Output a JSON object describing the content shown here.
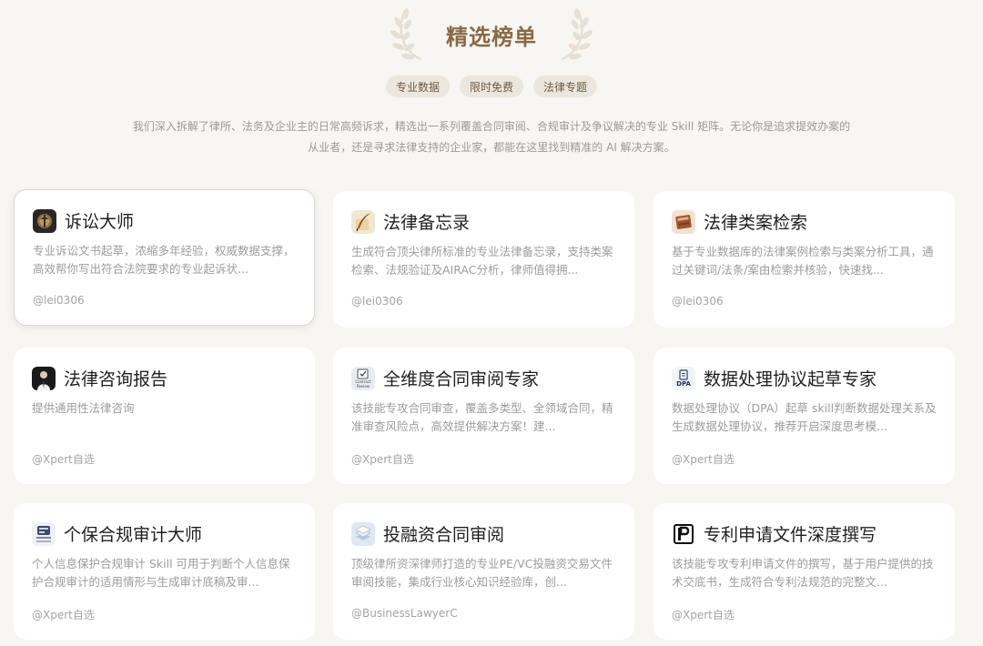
{
  "header": {
    "title": "精选榜单",
    "tags": [
      "专业数据",
      "限时免费",
      "法律专题"
    ],
    "intro_line1": "我们深入拆解了律所、法务及企业主的日常高频诉求，精选出一系列覆盖合同审阅、合规审计及争议解决的专业 Skill 矩阵。无论你是追求提效办案的",
    "intro_line2": "从业者，还是寻求法律支持的企业家，都能在这里找到精准的 AI 解决方案。"
  },
  "cards": [
    {
      "title": "诉讼大师",
      "desc": "专业诉讼文书起草，浓缩多年经验，权威数据支撑，高效帮你写出符合法院要求的专业起诉状...",
      "author": "@lei0306",
      "icon": "court-emblem-icon"
    },
    {
      "title": "法律备忘录",
      "desc": "生成符合顶尖律所标准的专业法律备忘录，支持类案检索、法规验证及AIRAC分析，律师值得拥...",
      "author": "@lei0306",
      "icon": "quill-paper-icon"
    },
    {
      "title": "法律类案检索",
      "desc": "基于专业数据库的法律案例检索与类案分析工具，通过关键词/法条/案由检索并核验，快速找...",
      "author": "@lei0306",
      "icon": "law-book-icon"
    },
    {
      "title": "法律咨询报告",
      "desc": "提供通用性法律咨询",
      "author": "@Xpert自选",
      "icon": "person-portrait-icon"
    },
    {
      "title": "全维度合同审阅专家",
      "desc": "该技能专攻合同审查，覆盖多类型、全领域合同，精准审查风险点，高效提供解决方案！建...",
      "author": "@Xpert自选",
      "icon": "contract-review-icon",
      "icon_caption": "Contract Review"
    },
    {
      "title": "数据处理协议起草专家",
      "desc": "数据处理协议（DPA）起草 skill判断数据处理关系及生成数据处理协议，推荐开启深度思考模...",
      "author": "@Xpert自选",
      "icon": "dpa-document-icon",
      "icon_caption": "DPA"
    },
    {
      "title": "个保合规审计大师",
      "desc": "个人信息保护合规审计 Skill 可用于判断个人信息保护合规审计的适用情形与生成审计底稿及审...",
      "author": "@Xpert自选",
      "icon": "privacy-audit-icon"
    },
    {
      "title": "投融资合同审阅",
      "desc": "顶级律所资深律师打造的专业PE/VC投融资交易文件审阅技能，集成行业核心知识经验库，创...",
      "author": "@BusinessLawyerC",
      "icon": "document-stack-icon"
    },
    {
      "title": "专利申请文件深度撰写",
      "desc": "该技能专攻专利申请文件的撰写，基于用户提供的技术交底书，生成符合专利法规范的完整文...",
      "author": "@Xpert自选",
      "icon": "patent-logo-icon"
    }
  ]
}
